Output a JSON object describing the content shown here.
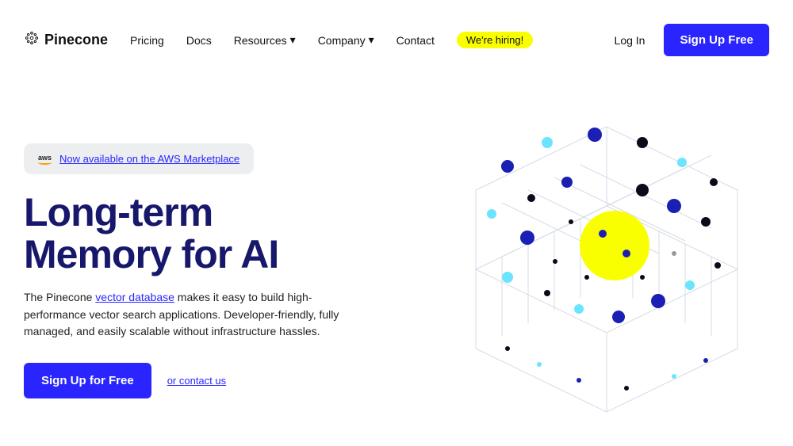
{
  "brand": "Pinecone",
  "nav": {
    "pricing": "Pricing",
    "docs": "Docs",
    "resources": "Resources",
    "company": "Company",
    "contact": "Contact",
    "hiring": "We're hiring!"
  },
  "header": {
    "login": "Log In",
    "signup": "Sign Up Free"
  },
  "hero": {
    "badge_prefix": "aws",
    "badge_link": "Now available on the AWS Marketplace",
    "title_line1": "Long-term",
    "title_line2": "Memory for AI",
    "sub_before": "The Pinecone ",
    "sub_link": "vector database",
    "sub_after": " makes it easy to build high-performance vector search applications. Developer-friendly, fully managed, and easily scalable without infrastructure hassles.",
    "cta": "Sign Up for Free",
    "contact": "or contact us"
  }
}
